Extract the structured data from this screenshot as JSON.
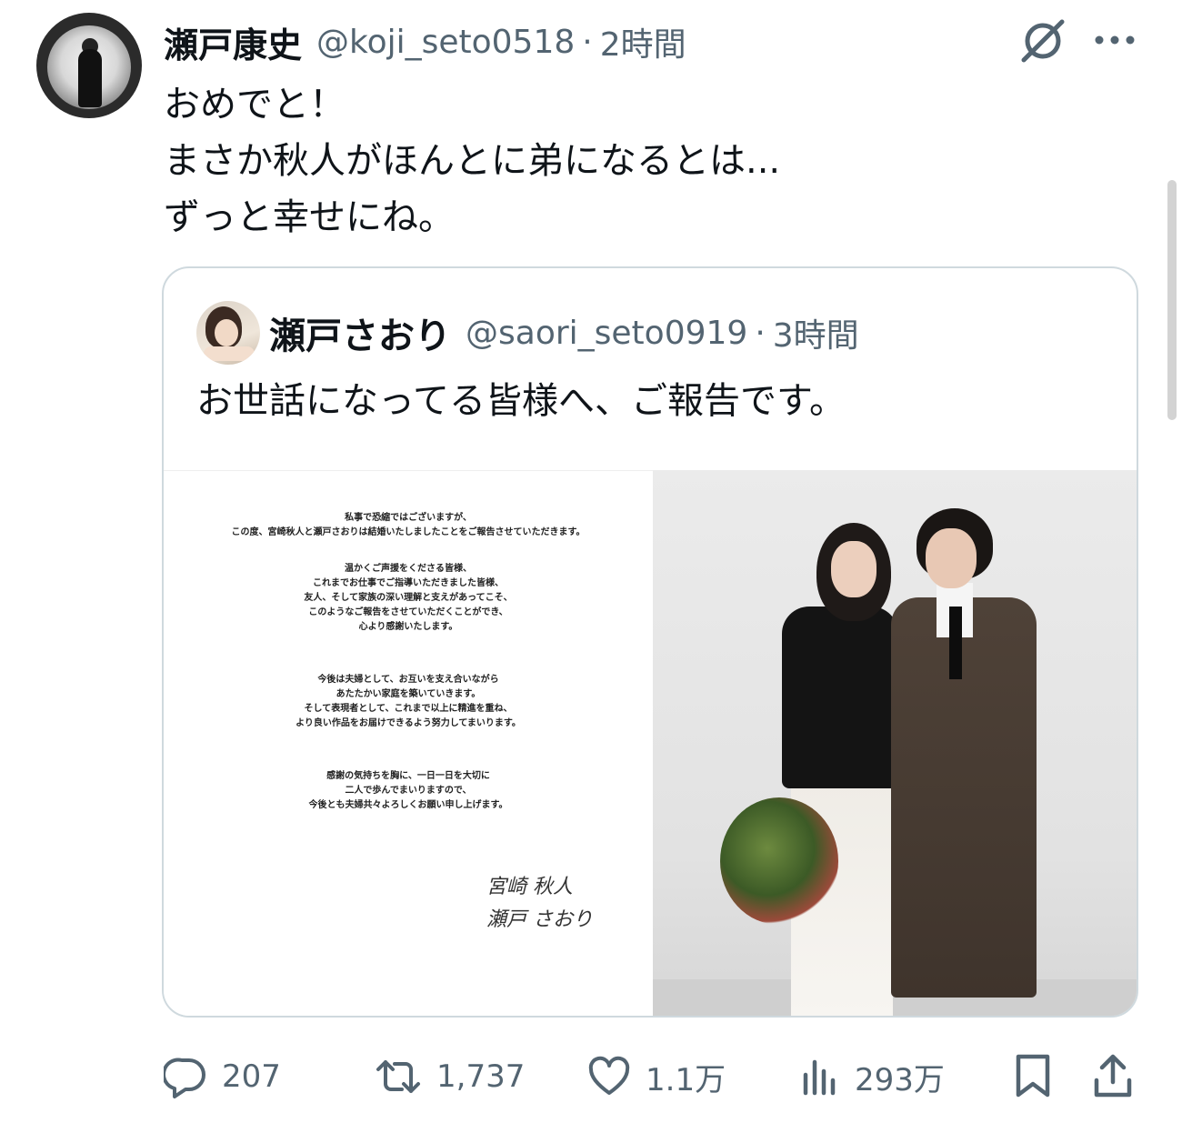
{
  "tweet": {
    "author": {
      "name": "瀬戸康史",
      "handle": "@koji_seto0518",
      "time": "2時間"
    },
    "text_lines": [
      "おめでと！",
      "まさか秋人がほんとに弟になるとは...",
      "ずっと幸せにね。"
    ]
  },
  "quote": {
    "author": {
      "name": "瀬戸さおり",
      "handle": "@saori_seto0919",
      "time": "3時間"
    },
    "text": "お世話になってる皆様へ、ご報告です。",
    "letter": {
      "lines": [
        "私事で恐縮ではございますが、",
        "この度、宮崎秋人と瀬戸さおりは結婚いたしましたことをご報告させていただきます。",
        "温かくご声援をくださる皆様、",
        "これまでお仕事でご指導いただきました皆様、",
        "友人、そして家族の深い理解と支えがあってこそ、",
        "このようなご報告をさせていただくことができ、",
        "心より感謝いたします。",
        "今後は夫婦として、お互いを支え合いながら",
        "あたたかい家庭を築いていきます。",
        "そして表現者として、これまで以上に精進を重ね、",
        "より良い作品をお届けできるよう努力してまいります。",
        "感謝の気持ちを胸に、一日一日を大切に",
        "二人で歩んでまいりますので、",
        "今後とも夫婦共々よろしくお願い申し上げます。"
      ],
      "signature": [
        "宮崎 秋人",
        "瀬戸 さおり"
      ]
    }
  },
  "actions": {
    "replies": "207",
    "reposts": "1,737",
    "likes": "1.1万",
    "views": "293万"
  },
  "icons": [
    "grok-icon",
    "more-icon",
    "reply-icon",
    "repost-icon",
    "like-icon",
    "views-icon",
    "bookmark-icon",
    "share-icon"
  ],
  "colors": {
    "text": "#0f1419",
    "secondary": "#536471",
    "border": "#cfd9de"
  }
}
